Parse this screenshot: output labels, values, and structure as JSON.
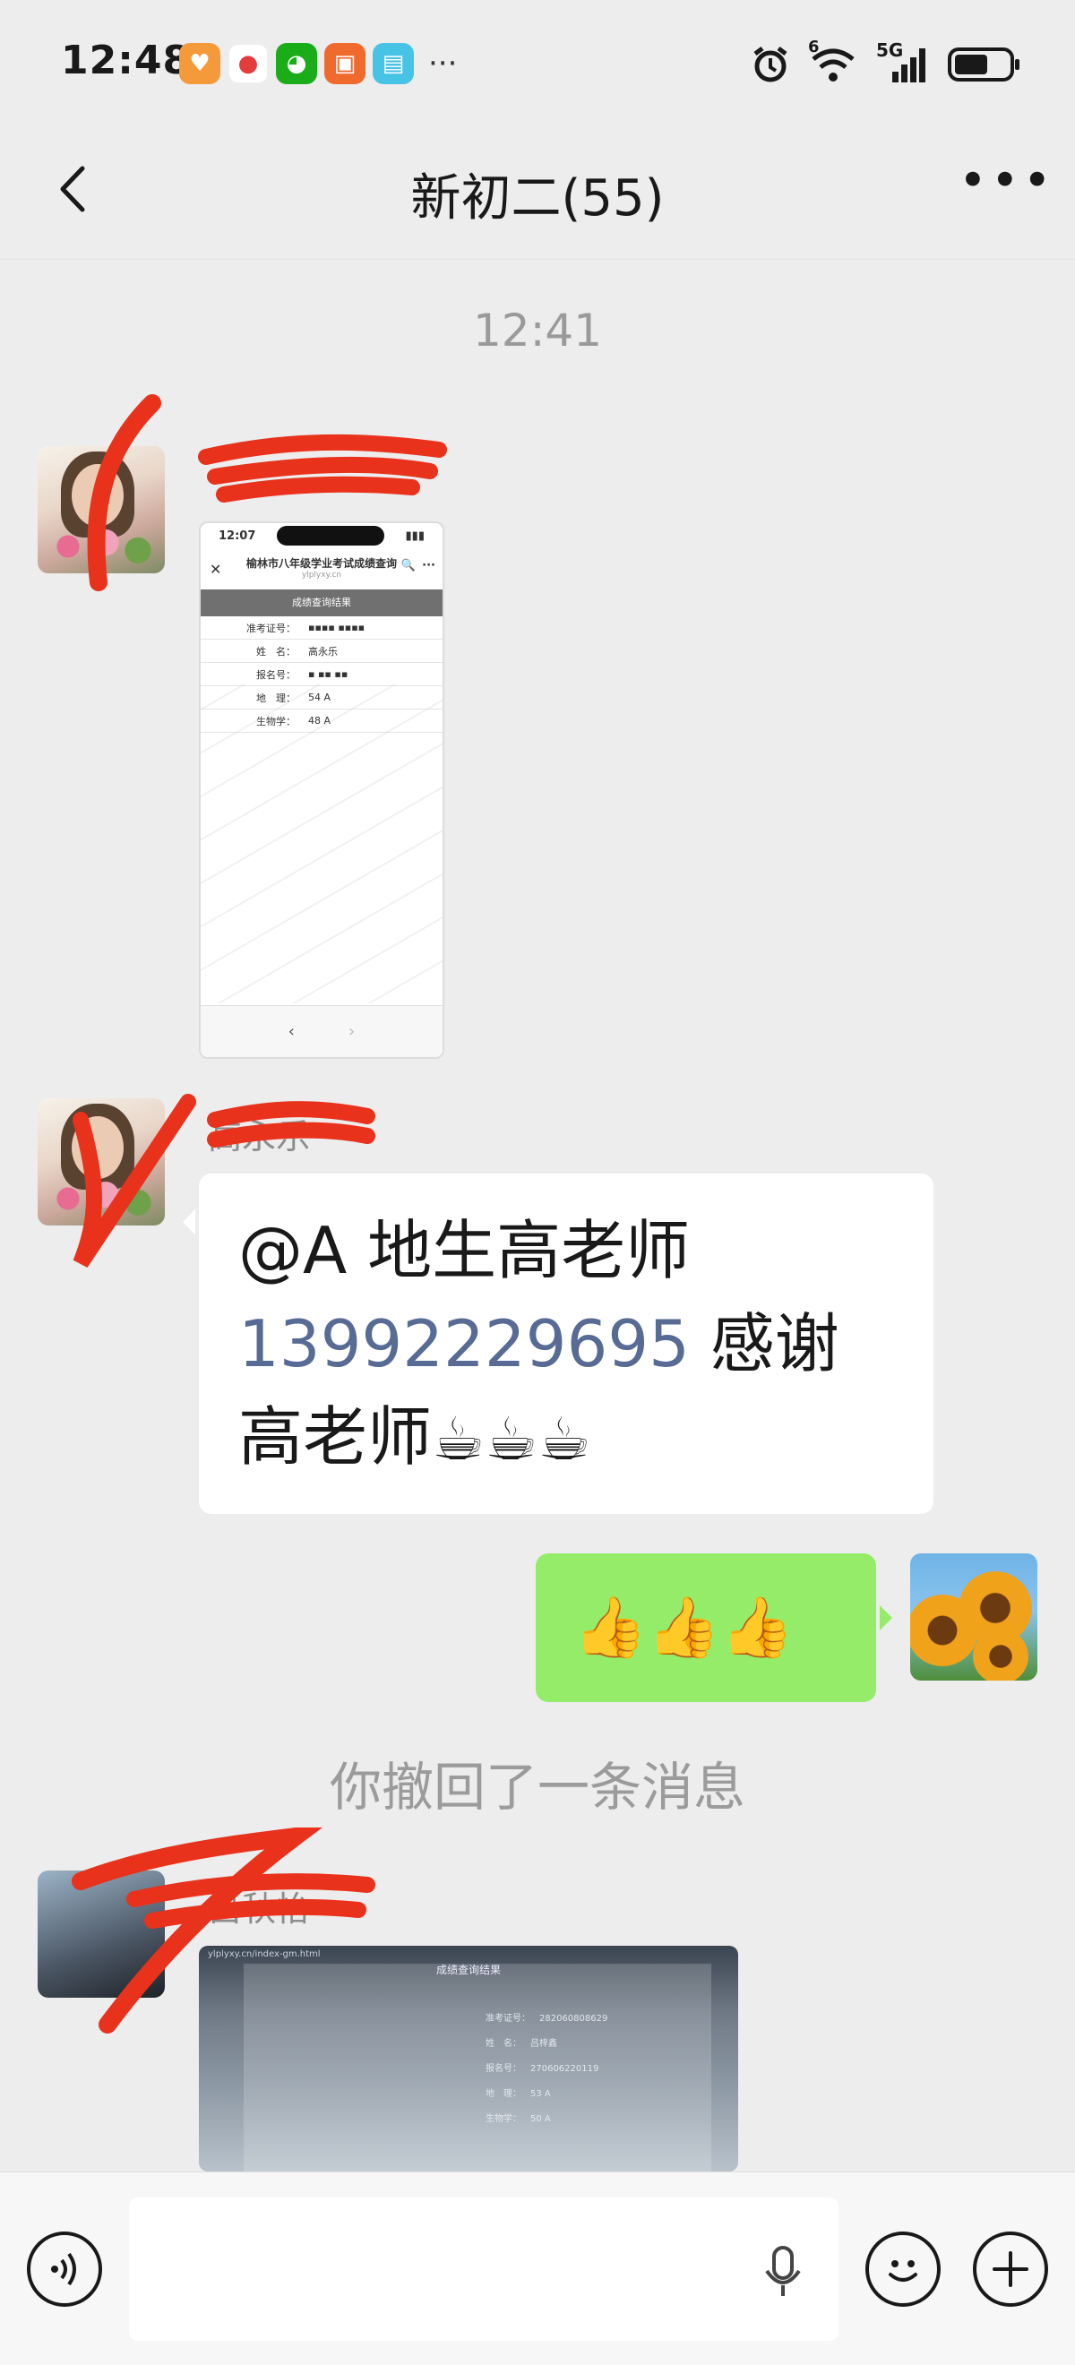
{
  "status_bar": {
    "time": "12:48",
    "more_indicator": "···",
    "wifi_badge": "6",
    "network": "5G",
    "app_icons": [
      "heart-app-icon",
      "red-app-icon",
      "wechat-icon",
      "orange-app-icon",
      "book-app-icon"
    ],
    "system_icons": [
      "alarm-icon",
      "wifi-icon",
      "signal-icon",
      "battery-icon"
    ],
    "battery_level": 0.55
  },
  "header": {
    "title": "新初二(55)",
    "back_icon": "chevron-left-icon",
    "more_icon": "more-horizontal-icon",
    "more_label": "•••"
  },
  "chat": {
    "time_label": "12:41",
    "messages": [
      {
        "type": "image",
        "direction": "in",
        "screenshot": {
          "time": "12:07",
          "title": "榆林市八年级学业考试成绩查询",
          "url": "ylplyxy.cn",
          "close": "✕",
          "search": "🔍",
          "menu": "···",
          "header": "成绩查询结果",
          "rows": [
            {
              "label": "准考证号：",
              "value": "▪▪▪▪ ▪▪▪▪"
            },
            {
              "label": "姓　名：",
              "value": "高永乐"
            },
            {
              "label": "报名号：",
              "value": "▪ ▪▪ ▪▪"
            },
            {
              "label": "地　理：",
              "value": "54  A"
            },
            {
              "label": "生物学：",
              "value": "48  A"
            }
          ],
          "nav_back": "‹",
          "nav_forward": "›"
        }
      },
      {
        "type": "text",
        "direction": "in",
        "sender_name": "高永乐",
        "mention": "@A 地生高老师",
        "phone": "13992229695",
        "text_after_phone": " 感谢",
        "text_line3": "高老师",
        "emoji": "☕☕☕"
      },
      {
        "type": "text",
        "direction": "out",
        "emoji": "👍👍👍"
      },
      {
        "type": "system",
        "text": "你撤回了一条消息"
      },
      {
        "type": "image",
        "direction": "in",
        "sender_name": "吕秋怡",
        "photo": {
          "url_bar": "ylplyxy.cn/index-gm.html",
          "header": "成绩查询结果",
          "rows": [
            {
              "label": "准考证号：",
              "value": "282060808629"
            },
            {
              "label": "姓　名：",
              "value": "吕梓鑫"
            },
            {
              "label": "报名号：",
              "value": "270606220119"
            },
            {
              "label": "地　理：",
              "value": "53  A"
            },
            {
              "label": "生物学：",
              "value": "50  A"
            }
          ]
        }
      }
    ]
  },
  "input_bar": {
    "voice_icon": "voice-icon",
    "mic_icon": "mic-icon",
    "emoji_icon": "emoji-icon",
    "add_icon": "plus-icon",
    "input_value": ""
  },
  "colors": {
    "background": "#ededed",
    "bubble_out": "#95ec69",
    "bubble_in": "#ffffff",
    "link": "#576b95",
    "scribble": "#e8321c"
  }
}
